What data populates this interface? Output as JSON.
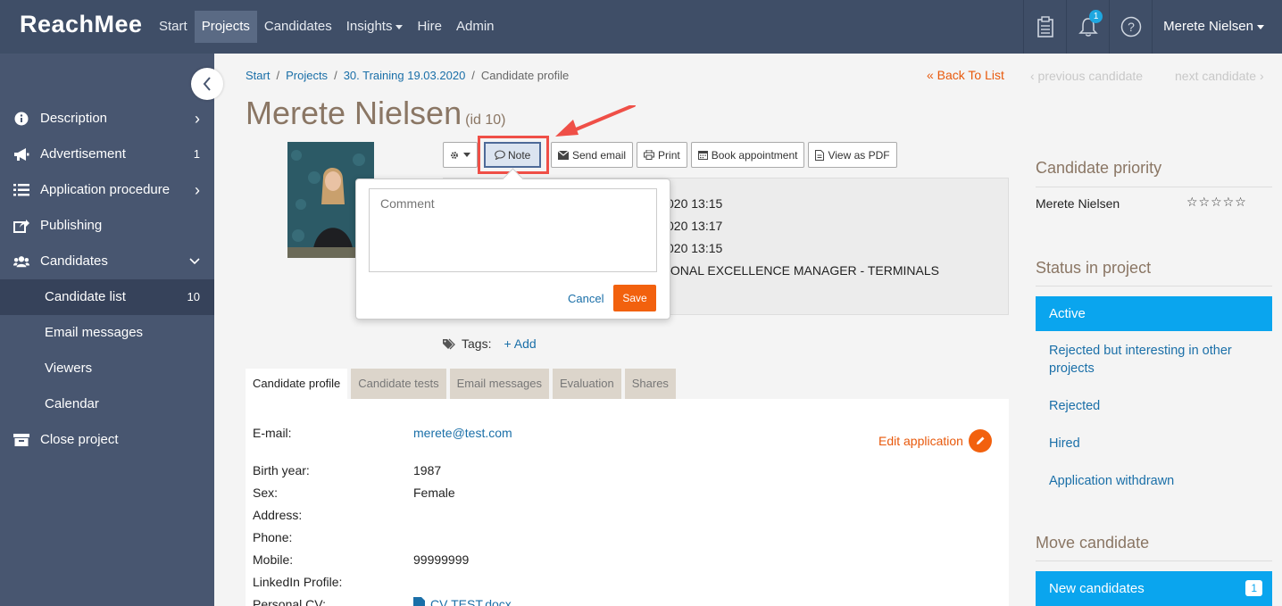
{
  "brand": "ReachMee",
  "topnav": [
    {
      "label": "Start",
      "active": false
    },
    {
      "label": "Projects",
      "active": true
    },
    {
      "label": "Candidates",
      "active": false
    },
    {
      "label": "Insights",
      "active": false,
      "dropdown": true
    },
    {
      "label": "Hire",
      "active": false
    },
    {
      "label": "Admin",
      "active": false
    }
  ],
  "notifications_count": "1",
  "user_name": "Merete Nielsen",
  "sidebar": {
    "items": [
      {
        "label": "Description",
        "right": "›"
      },
      {
        "label": "Advertisement",
        "right": "1"
      },
      {
        "label": "Application procedure",
        "right": "›"
      },
      {
        "label": "Publishing",
        "right": ""
      },
      {
        "label": "Candidates",
        "right": "⌄"
      },
      {
        "label": "Candidate list",
        "right": "10"
      },
      {
        "label": "Email messages",
        "right": ""
      },
      {
        "label": "Viewers",
        "right": ""
      },
      {
        "label": "Calendar",
        "right": ""
      },
      {
        "label": "Close project",
        "right": ""
      }
    ]
  },
  "breadcrumb": {
    "start": "Start",
    "projects": "Projects",
    "project": "30. Training 19.03.2020",
    "current": "Candidate profile"
  },
  "nav_links": {
    "back": "« Back To List",
    "prev": "‹ previous candidate",
    "next": "next candidate ›"
  },
  "candidate": {
    "name": "Merete Nielsen",
    "id_label": "(id 10)"
  },
  "toolbar": {
    "note": "Note",
    "send_email": "Send email",
    "print": "Print",
    "book": "Book appointment",
    "pdf": "View as PDF"
  },
  "info_lines": [
    "020 13:15",
    "020 13:17",
    "020 13:15",
    "IONAL EXCELLENCE MANAGER - TERMINALS"
  ],
  "popover": {
    "placeholder": "Comment",
    "cancel": "Cancel",
    "save": "Save"
  },
  "tags": {
    "label": "Tags:",
    "add": "+ Add"
  },
  "tabs": [
    "Candidate profile",
    "Candidate tests",
    "Email messages",
    "Evaluation",
    "Shares"
  ],
  "profile": {
    "email_label": "E-mail:",
    "email": "merete@test.com",
    "birth_label": "Birth year:",
    "birth": "1987",
    "sex_label": "Sex:",
    "sex": "Female",
    "address_label": "Address:",
    "phone_label": "Phone:",
    "mobile_label": "Mobile:",
    "mobile": "99999999",
    "linkedin_label": "LinkedIn Profile:",
    "cv_label": "Personal CV:",
    "cv": "CV TEST.docx",
    "edit": "Edit application"
  },
  "right": {
    "priority_title": "Candidate priority",
    "priority_name": "Merete Nielsen",
    "stars": "☆☆☆☆☆",
    "status_title": "Status in project",
    "status_active": "Active",
    "status_options": [
      "Rejected but interesting in other projects",
      "Rejected",
      "Hired",
      "Application withdrawn"
    ],
    "move_title": "Move candidate",
    "move_btn": "New candidates",
    "move_count": "1"
  }
}
